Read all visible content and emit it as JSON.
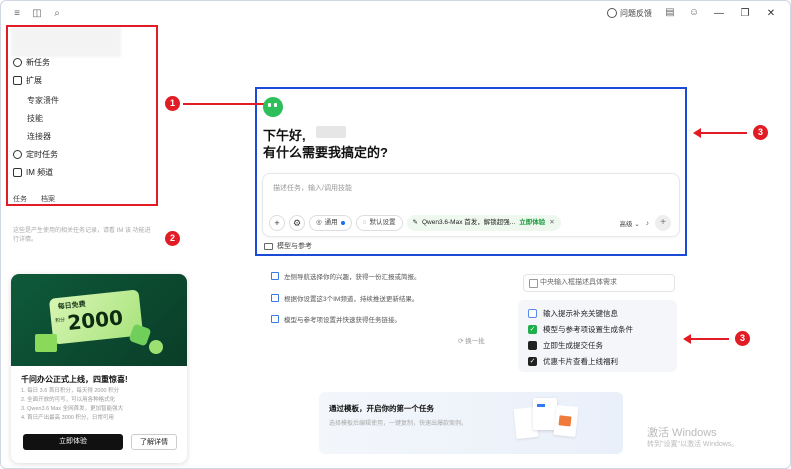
{
  "topbar": {
    "feedback_label": "问题反馈",
    "minimize": "—",
    "maximize": "❐",
    "close": "✕"
  },
  "sidebar": {
    "new_task": "新任务",
    "extend": "扩展",
    "sub_items": [
      "专家溃件",
      "技能",
      "连接器"
    ],
    "scheduled": "定时任务",
    "im_channel": "IM 频道",
    "footer": [
      "任务",
      "档案"
    ],
    "note": "这些是产生使用的相关任务记录，请看 IM 该 功能进行详情。"
  },
  "annotations": {
    "badge1": "1",
    "badge2": "2",
    "badge3a": "3",
    "badge3b": "3"
  },
  "promo": {
    "ticket_top": "每日免费",
    "ticket_num": "2000",
    "ticket_unit": "积分",
    "title": "千问办公正式上线，四重惊喜!",
    "list": [
      "1. 每日 3.6 首日积分，每天得 2000 积分",
      "2. 全面开放的可写，可以用各种格式化",
      "3. Qwen3.6 Max 全网首发，更加智能强大",
      "4. 首日产出最高 3000 积分，日常可用"
    ],
    "primary_btn": "立即体验",
    "secondary_btn": "了解详情"
  },
  "main": {
    "greeting": "下午好,",
    "question": "有什么需要我搞定的?",
    "placeholder": "描述任务，输入/调用技能",
    "tool_plus": "+",
    "pill_web": "通用",
    "pill_default": "默认设置",
    "model_text": "Qwen3.6-Max 首发，解锁超强...",
    "model_action": "立即体验",
    "model_close": "✕",
    "advanced": "高级",
    "send": "+",
    "template_tab": "模型与参考"
  },
  "tips": [
    "左侧导航选择你的兴趣，获得一份汇报或简报。",
    "根据你设置这3个IM频道，持续推送更新结果。",
    "模型与参考项设置并快速获得任务链接。"
  ],
  "refresh_label": "换一批",
  "side_prompt": "中央输入框描述具体需求",
  "checklist": [
    {
      "label": "输入提示补充关键信息",
      "style": "doc",
      "mark": ""
    },
    {
      "label": "模型与参考项设置生成条件",
      "style": "green",
      "mark": "✓"
    },
    {
      "label": "立即生成提交任务",
      "style": "black",
      "mark": ""
    },
    {
      "label": "优惠卡片查看上线福利",
      "style": "black",
      "mark": "✓"
    }
  ],
  "bottom_card": {
    "title": "通过模板，开启你的第一个任务",
    "subtitle": "选择模板后编辑使用，一键复制，快速出爆款案例。"
  },
  "watermark": {
    "line1": "激活 Windows",
    "line2": "转到\"设置\"以激活 Windows。"
  },
  "colors": {
    "annotation_red": "#e21c24",
    "annotation_blue": "#1b4bd6",
    "brand_green": "#2fbf5a"
  }
}
